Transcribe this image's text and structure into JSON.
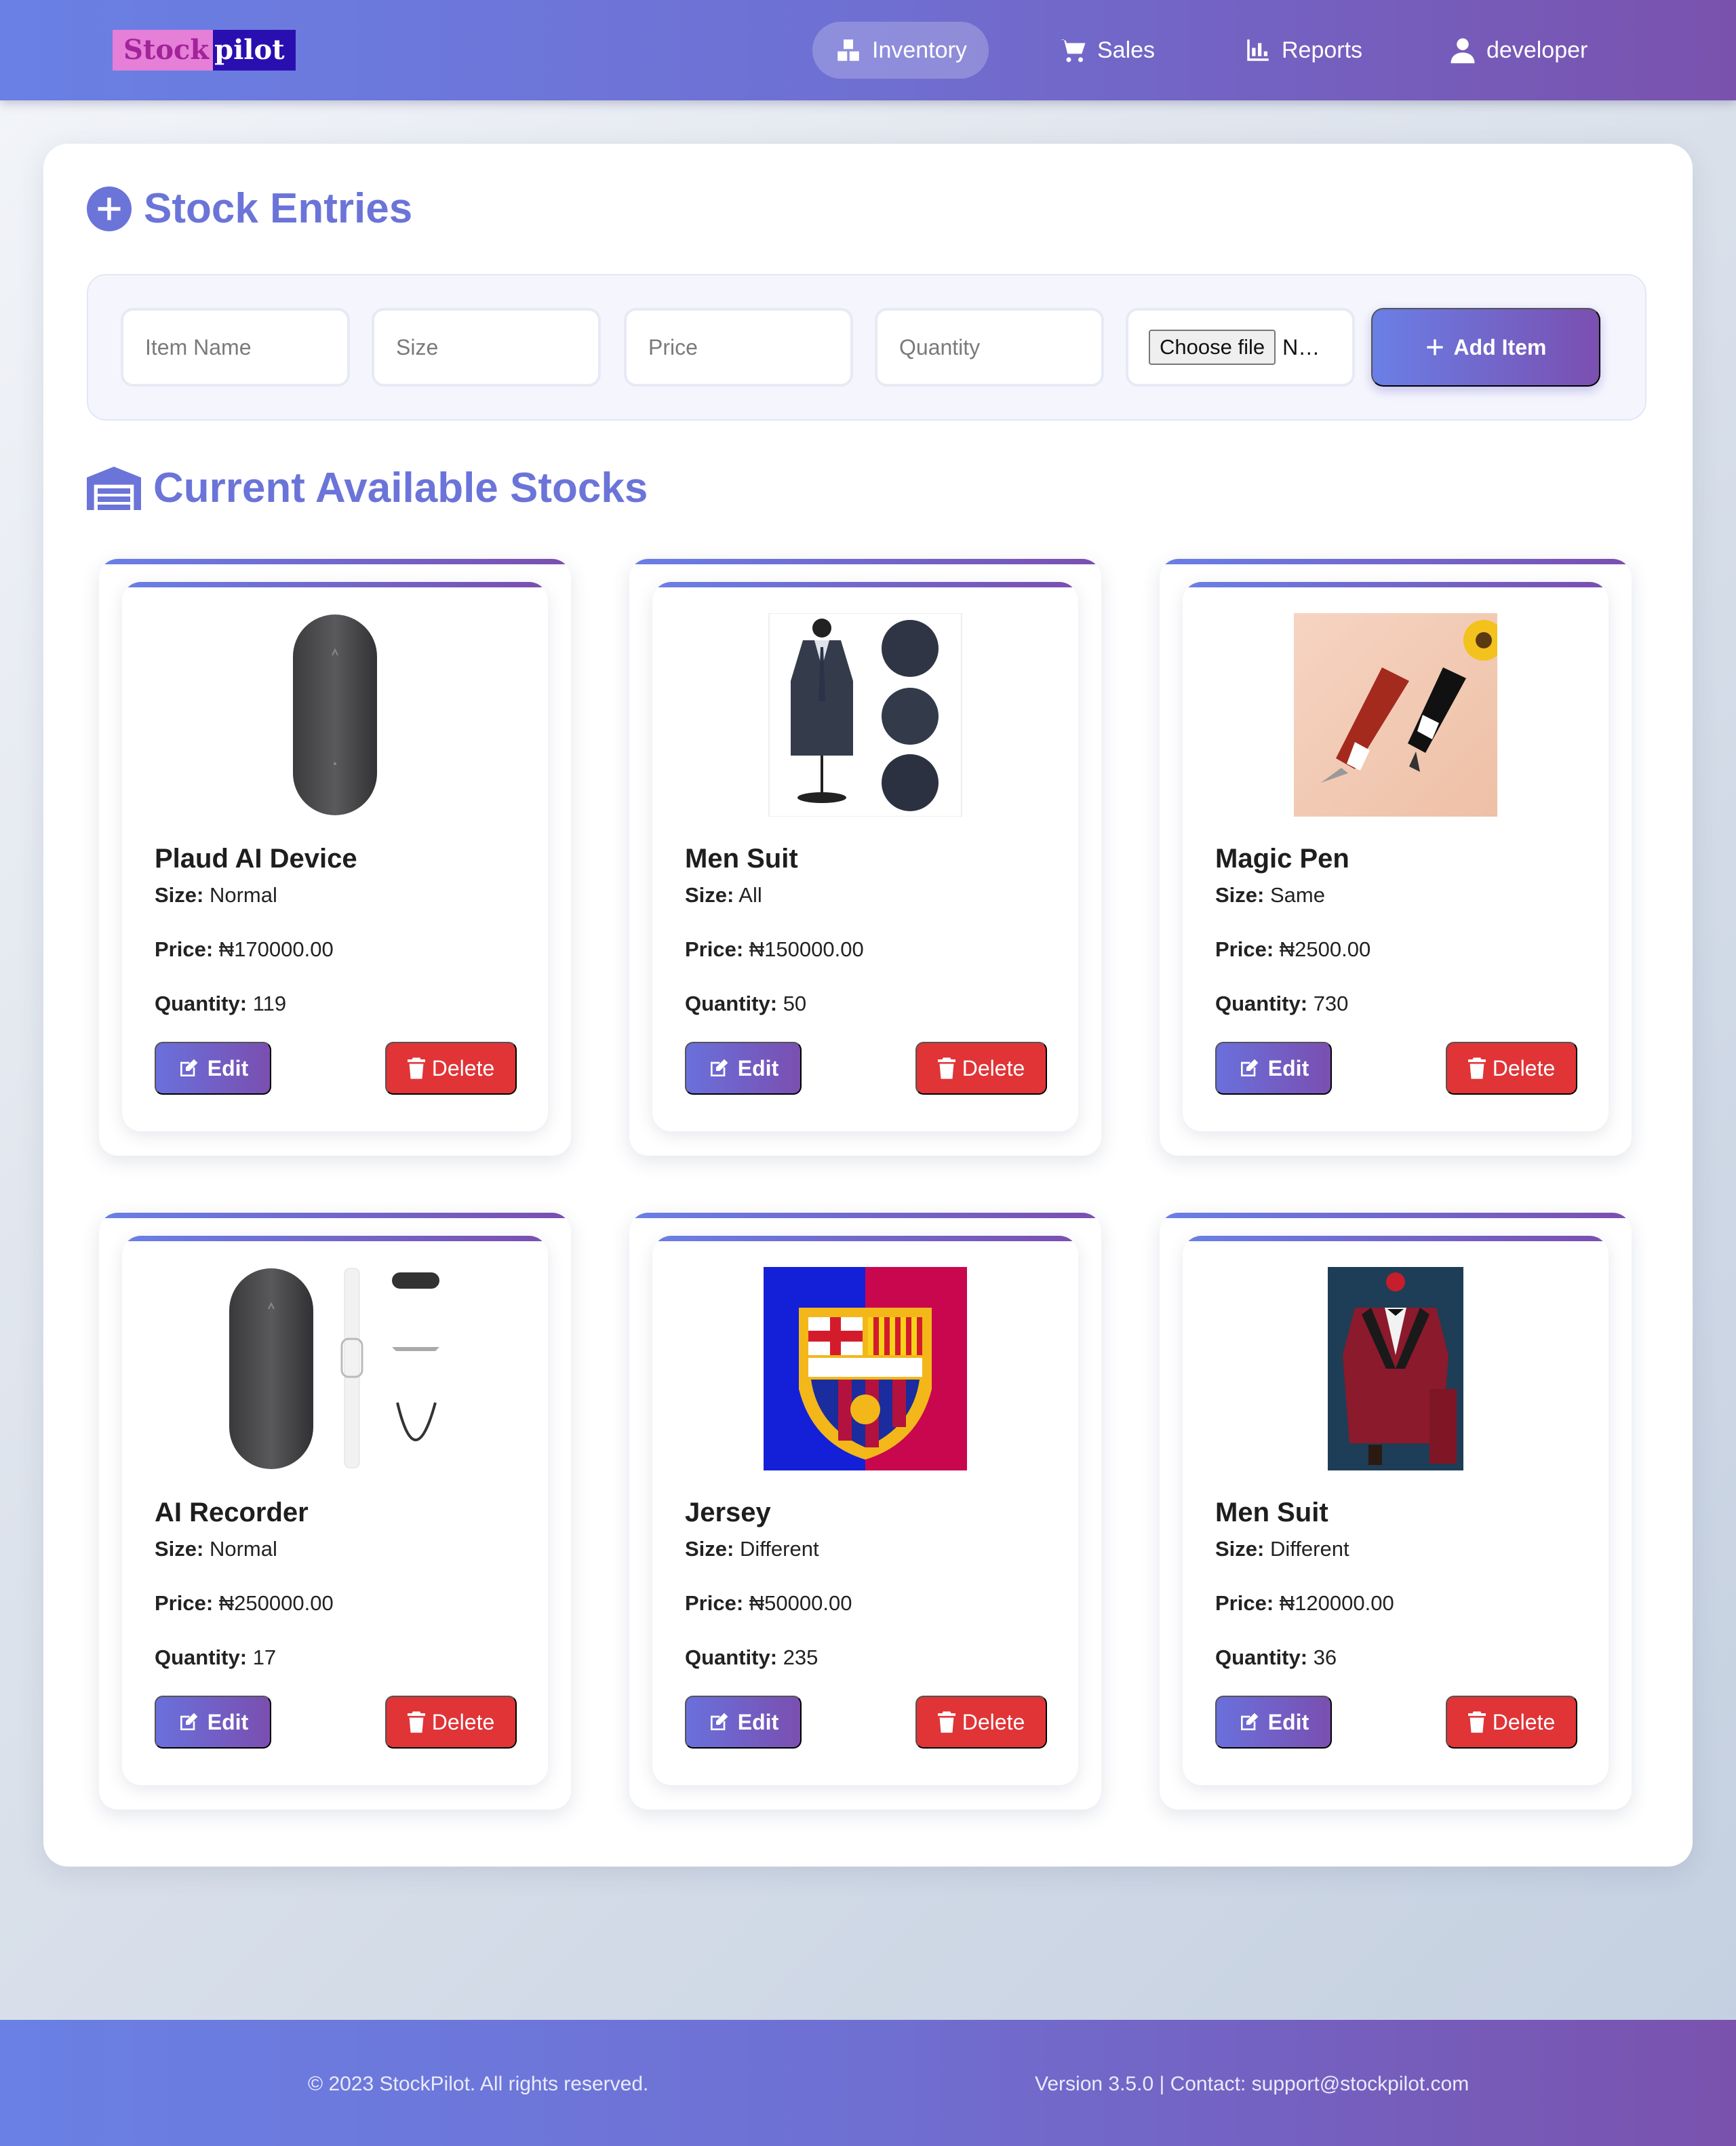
{
  "brand": {
    "part1": "Stock",
    "part2": "pilot"
  },
  "nav": {
    "inventory": "Inventory",
    "sales": "Sales",
    "reports": "Reports",
    "user": "developer"
  },
  "entries": {
    "title": "Stock Entries",
    "item_name_placeholder": "Item Name",
    "size_placeholder": "Size",
    "price_placeholder": "Price",
    "quantity_placeholder": "Quantity",
    "file_button": "Choose file",
    "file_name": "N…",
    "add_button": "Add Item"
  },
  "stocks": {
    "title": "Current Available Stocks",
    "size_label": "Size:",
    "price_label": "Price:",
    "quantity_label": "Quantity:",
    "edit_label": "Edit",
    "delete_label": "Delete",
    "items": [
      {
        "name": "Plaud AI Device",
        "size": "Normal",
        "price": "₦170000.00",
        "quantity": "119"
      },
      {
        "name": "Men Suit",
        "size": "All",
        "price": "₦150000.00",
        "quantity": "50"
      },
      {
        "name": "Magic Pen",
        "size": "Same",
        "price": "₦2500.00",
        "quantity": "730"
      },
      {
        "name": "AI Recorder",
        "size": "Normal",
        "price": "₦250000.00",
        "quantity": "17"
      },
      {
        "name": "Jersey",
        "size": "Different",
        "price": "₦50000.00",
        "quantity": "235"
      },
      {
        "name": "Men Suit",
        "size": "Different",
        "price": "₦120000.00",
        "quantity": "36"
      }
    ]
  },
  "footer": {
    "copyright": "© 2023 StockPilot. All rights reserved.",
    "version": "Version 3.5.0 | Contact: support@stockpilot.com"
  },
  "colors": {
    "accent": "#6b74d8",
    "danger": "#e03437",
    "nav_start": "#6a80e4",
    "nav_end": "#7a52ae"
  }
}
